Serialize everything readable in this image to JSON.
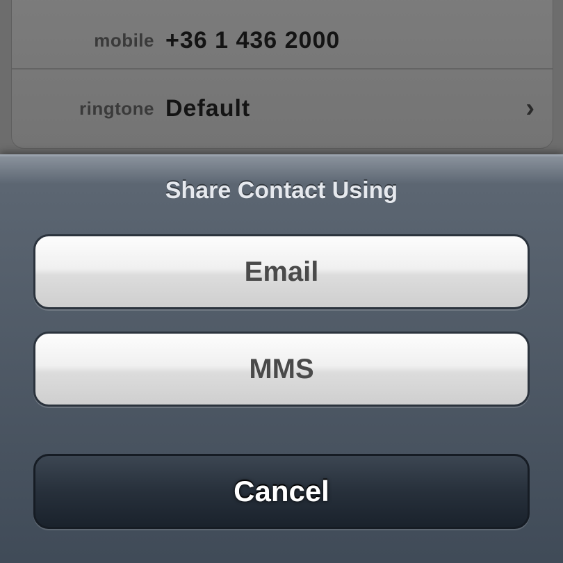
{
  "contact": {
    "rows": [
      {
        "label": "mobile",
        "value": "+36 1 436 2000"
      },
      {
        "label": "ringtone",
        "value": "Default",
        "chevron": "›"
      }
    ]
  },
  "action_sheet": {
    "title": "Share Contact Using",
    "buttons": {
      "email": "Email",
      "mms": "MMS",
      "cancel": "Cancel"
    }
  },
  "colors": {
    "sheet_background": "#4a5562",
    "button_light": "#e6e6e6",
    "button_dark": "#222b35"
  }
}
